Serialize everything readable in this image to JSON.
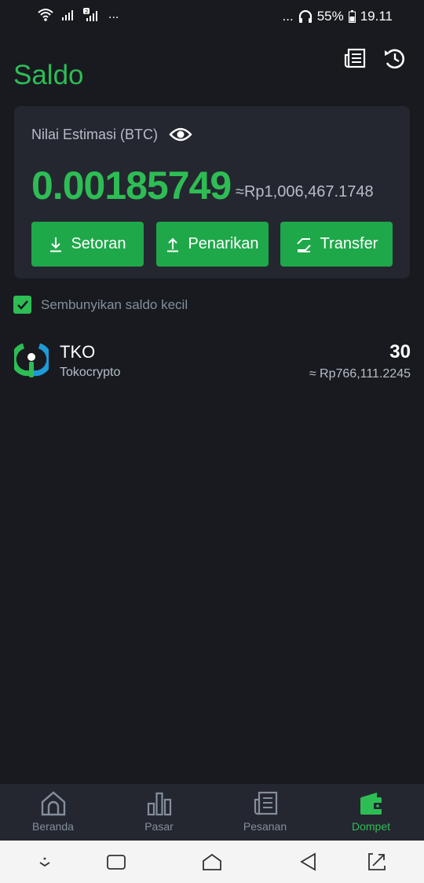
{
  "status_bar": {
    "left_dots": "...",
    "right_dots": "...",
    "battery": "55%",
    "time": "19.11"
  },
  "header": {
    "title": "Saldo",
    "news_icon": "news-icon",
    "history_icon": "history-icon"
  },
  "balance_card": {
    "estimate_label": "Nilai Estimasi (BTC)",
    "btc_value": "0.00185749",
    "idr_value": "≈Rp1,006,467.1748",
    "buttons": {
      "deposit": "Setoran",
      "withdraw": "Penarikan",
      "transfer": "Transfer"
    }
  },
  "hide_small_balance": {
    "label": "Sembunyikan saldo kecil",
    "checked": true
  },
  "assets": [
    {
      "symbol": "TKO",
      "name": "Tokocrypto",
      "amount": "30",
      "idr_value": "≈ Rp766,111.2245"
    }
  ],
  "bottom_nav": {
    "items": [
      {
        "label": "Beranda",
        "icon": "home-icon"
      },
      {
        "label": "Pasar",
        "icon": "bar-chart-icon"
      },
      {
        "label": "Pesanan",
        "icon": "orders-icon"
      },
      {
        "label": "Dompet",
        "icon": "wallet-icon",
        "active": true
      }
    ]
  },
  "colors": {
    "accent": "#2ebd55",
    "background": "#181a20",
    "card": "#242730"
  }
}
